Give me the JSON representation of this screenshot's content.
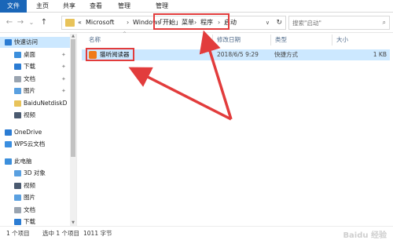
{
  "ribbon": {
    "tabs": [
      "文件",
      "主页",
      "共享",
      "查看",
      "管理",
      "管理"
    ]
  },
  "nav": {
    "back": "←",
    "forward": "→",
    "recent": "⌄",
    "up": "↑"
  },
  "address": {
    "prefix": "«",
    "crumbs": [
      "Microsoft",
      "Windows",
      "「开始」菜单",
      "程序",
      "启动"
    ],
    "dropdown": "∨",
    "refresh": "↻"
  },
  "search": {
    "placeholder": "搜索\"启动\"",
    "icon": "search-icon"
  },
  "sidebar": {
    "items": [
      {
        "label": "快速访问",
        "icon": "star-icon",
        "color": "#2b7cd3",
        "pinned": false,
        "selected": true,
        "indent": 0
      },
      {
        "label": "桌面",
        "icon": "desktop-icon",
        "color": "#3c8fdc",
        "pinned": true,
        "selected": false,
        "indent": 1
      },
      {
        "label": "下载",
        "icon": "download-icon",
        "color": "#2b7cd3",
        "pinned": true,
        "selected": false,
        "indent": 1
      },
      {
        "label": "文档",
        "icon": "document-icon",
        "color": "#9aa4b0",
        "pinned": true,
        "selected": false,
        "indent": 1
      },
      {
        "label": "图片",
        "icon": "picture-icon",
        "color": "#5aa0e0",
        "pinned": true,
        "selected": false,
        "indent": 1
      },
      {
        "label": "BaiduNetdiskD",
        "icon": "folder-icon",
        "color": "#e8c35a",
        "pinned": false,
        "selected": false,
        "indent": 1
      },
      {
        "label": "视频",
        "icon": "video-icon",
        "color": "#4a5a70",
        "pinned": false,
        "selected": false,
        "indent": 1
      },
      {
        "label": "OneDrive",
        "icon": "cloud-icon",
        "color": "#2b7cd3",
        "pinned": false,
        "selected": false,
        "indent": 0
      },
      {
        "label": "WPS云文档",
        "icon": "cloud-icon",
        "color": "#3a8ee0",
        "pinned": false,
        "selected": false,
        "indent": 0
      },
      {
        "label": "此电脑",
        "icon": "computer-icon",
        "color": "#3c8fdc",
        "pinned": false,
        "selected": false,
        "indent": 0
      },
      {
        "label": "3D 对象",
        "icon": "cube-icon",
        "color": "#5aa0e0",
        "pinned": false,
        "selected": false,
        "indent": 1
      },
      {
        "label": "视频",
        "icon": "video-icon",
        "color": "#4a5a70",
        "pinned": false,
        "selected": false,
        "indent": 1
      },
      {
        "label": "图片",
        "icon": "picture-icon",
        "color": "#5aa0e0",
        "pinned": false,
        "selected": false,
        "indent": 1
      },
      {
        "label": "文档",
        "icon": "document-icon",
        "color": "#9aa4b0",
        "pinned": false,
        "selected": false,
        "indent": 1
      },
      {
        "label": "下载",
        "icon": "download-icon",
        "color": "#2b7cd3",
        "pinned": false,
        "selected": false,
        "indent": 1
      }
    ],
    "pin_glyph": "✦"
  },
  "columns": {
    "name": "名称",
    "modified": "修改日期",
    "type": "类型",
    "size": "大小"
  },
  "files": [
    {
      "name": "猫听阅读器",
      "modified": "2018/6/5 9:29",
      "type": "快捷方式",
      "size": "1 KB",
      "icon": "app-shortcut-icon"
    }
  ],
  "status": {
    "count": "1 个项目",
    "selected": "选中 1 个项目",
    "bytes": "1011 字节"
  },
  "watermark": "Baidu 经验",
  "colors": {
    "accent": "#1a66b8",
    "selection": "#cce8ff",
    "highlight": "#e23c3c"
  }
}
